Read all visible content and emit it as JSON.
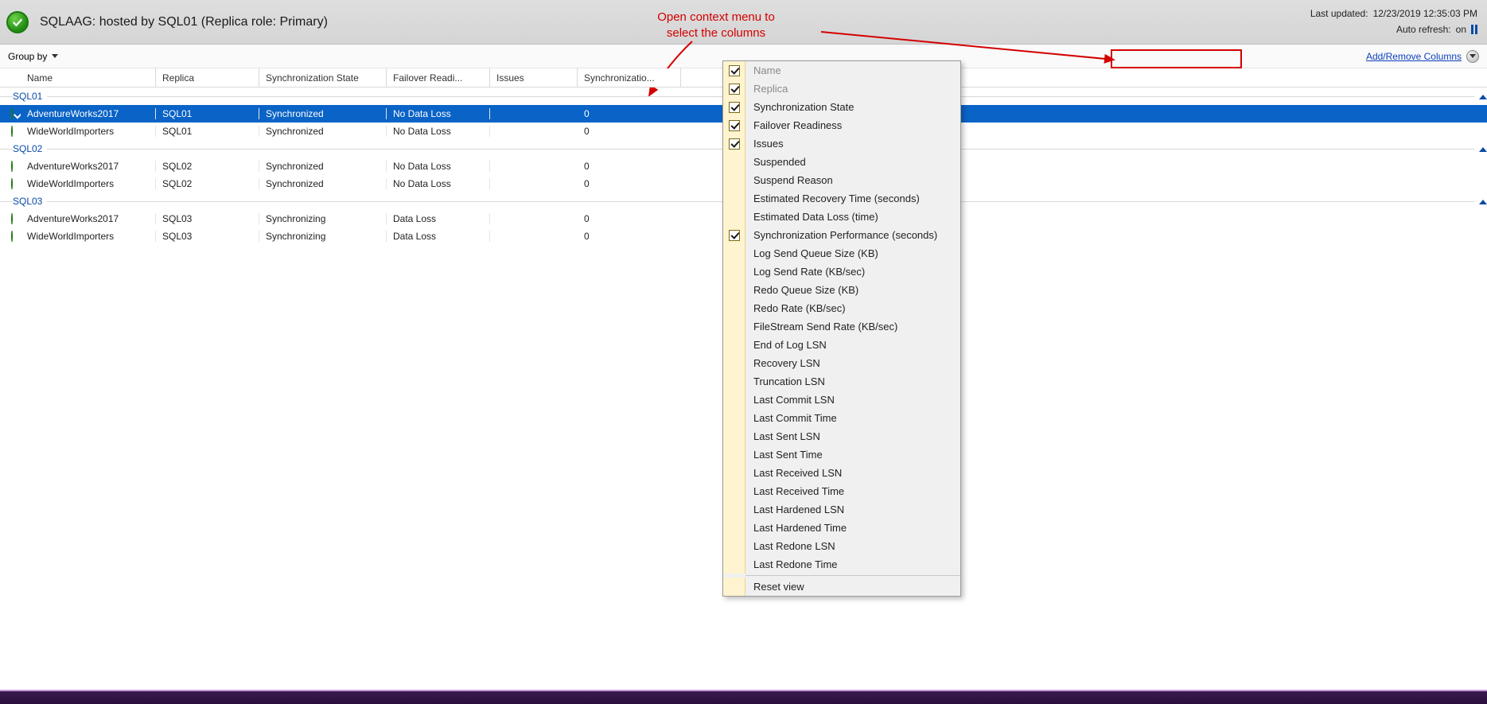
{
  "header": {
    "title": "SQLAAG: hosted by SQL01 (Replica role: Primary)",
    "last_updated_label": "Last updated:",
    "last_updated_value": "12/23/2019 12:35:03 PM",
    "auto_refresh_label": "Auto refresh:",
    "auto_refresh_value": "on"
  },
  "annotation": {
    "line1": "Open context menu to",
    "line2": "select the columns"
  },
  "toolbar": {
    "groupby_label": "Group by",
    "add_remove_columns": "Add/Remove Columns"
  },
  "columns": {
    "name": "Name",
    "replica": "Replica",
    "sync_state": "Synchronization State",
    "failover": "Failover Readi...",
    "issues": "Issues",
    "sync_perf": "Synchronizatio..."
  },
  "groups": [
    {
      "name": "SQL01",
      "rows": [
        {
          "db": "AdventureWorks2017",
          "replica": "SQL01",
          "sync": "Synchronized",
          "fail": "No Data Loss",
          "issues": "",
          "perf": "0",
          "selected": true
        },
        {
          "db": "WideWorldImporters",
          "replica": "SQL01",
          "sync": "Synchronized",
          "fail": "No Data Loss",
          "issues": "",
          "perf": "0"
        }
      ]
    },
    {
      "name": "SQL02",
      "rows": [
        {
          "db": "AdventureWorks2017",
          "replica": "SQL02",
          "sync": "Synchronized",
          "fail": "No Data Loss",
          "issues": "",
          "perf": "0"
        },
        {
          "db": "WideWorldImporters",
          "replica": "SQL02",
          "sync": "Synchronized",
          "fail": "No Data Loss",
          "issues": "",
          "perf": "0"
        }
      ]
    },
    {
      "name": "SQL03",
      "rows": [
        {
          "db": "AdventureWorks2017",
          "replica": "SQL03",
          "sync": "Synchronizing",
          "fail": "Data Loss",
          "issues": "",
          "perf": "0"
        },
        {
          "db": "WideWorldImporters",
          "replica": "SQL03",
          "sync": "Synchronizing",
          "fail": "Data Loss",
          "issues": "",
          "perf": "0"
        }
      ]
    }
  ],
  "context_menu": {
    "items": [
      {
        "label": "Name",
        "checked": true,
        "disabled": true
      },
      {
        "label": "Replica",
        "checked": true,
        "disabled": true
      },
      {
        "label": "Synchronization State",
        "checked": true
      },
      {
        "label": "Failover Readiness",
        "checked": true
      },
      {
        "label": "Issues",
        "checked": true
      },
      {
        "label": "Suspended",
        "checked": false
      },
      {
        "label": "Suspend Reason",
        "checked": false
      },
      {
        "label": "Estimated Recovery Time (seconds)",
        "checked": false
      },
      {
        "label": "Estimated Data Loss (time)",
        "checked": false
      },
      {
        "label": "Synchronization Performance (seconds)",
        "checked": true
      },
      {
        "label": "Log Send Queue Size (KB)",
        "checked": false
      },
      {
        "label": "Log Send Rate (KB/sec)",
        "checked": false
      },
      {
        "label": "Redo Queue Size (KB)",
        "checked": false
      },
      {
        "label": "Redo Rate (KB/sec)",
        "checked": false
      },
      {
        "label": "FileStream Send Rate (KB/sec)",
        "checked": false
      },
      {
        "label": "End of Log LSN",
        "checked": false
      },
      {
        "label": "Recovery LSN",
        "checked": false
      },
      {
        "label": "Truncation LSN",
        "checked": false
      },
      {
        "label": "Last Commit LSN",
        "checked": false
      },
      {
        "label": "Last Commit Time",
        "checked": false
      },
      {
        "label": "Last Sent LSN",
        "checked": false
      },
      {
        "label": "Last Sent Time",
        "checked": false
      },
      {
        "label": "Last Received LSN",
        "checked": false
      },
      {
        "label": "Last Received Time",
        "checked": false
      },
      {
        "label": "Last Hardened LSN",
        "checked": false
      },
      {
        "label": "Last Hardened Time",
        "checked": false
      },
      {
        "label": "Last Redone LSN",
        "checked": false
      },
      {
        "label": "Last Redone Time",
        "checked": false
      }
    ],
    "reset": "Reset view"
  }
}
